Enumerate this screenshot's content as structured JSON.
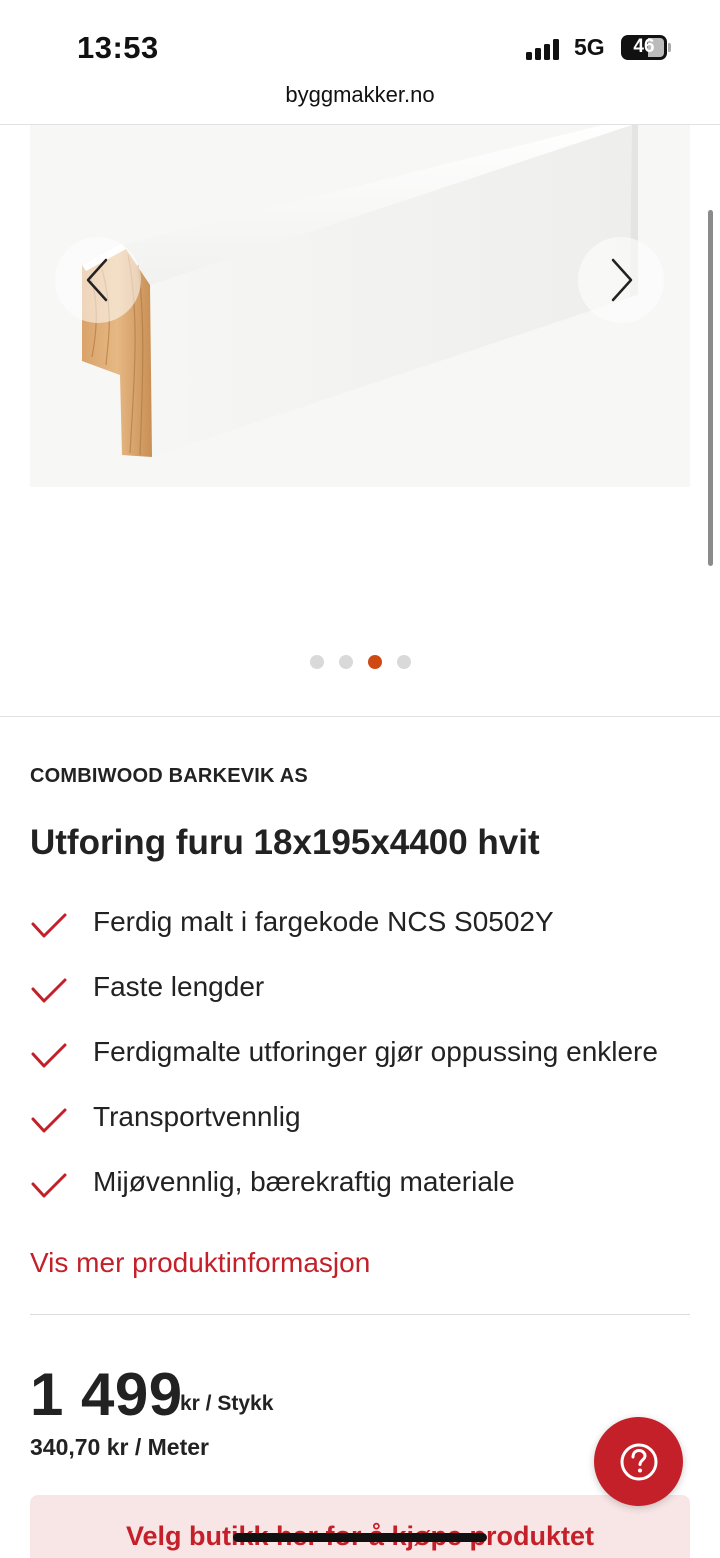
{
  "status_bar": {
    "time": "13:53",
    "network": "5G",
    "battery": "46"
  },
  "browser": {
    "url": "byggmakker.no"
  },
  "gallery": {
    "image": "white-painted-pine-casing-board",
    "prev_icon": "chevron-left-icon",
    "next_icon": "chevron-right-icon",
    "dots_count": 4,
    "active_dot": 3,
    "active_color": "#cf4a12"
  },
  "product": {
    "brand": "COMBIWOOD BARKEVIK AS",
    "title": "Utforing furu 18x195x4400 hvit",
    "features": [
      "Ferdig malt i fargekode NCS S0502Y",
      "Faste lengder",
      "Ferdigmalte utforinger gjør oppussing enklere",
      "Transportvennlig",
      "Mijøvennlig, bærekraftig materiale"
    ],
    "more_info_link": "Vis mer produktinformasjon"
  },
  "price": {
    "amount": "1 499",
    "unit": "kr / Stykk",
    "per_meter": "340,70 kr / Meter"
  },
  "help": {
    "icon": "question-mark-icon"
  },
  "cta": {
    "label": "Velg butikk her for å kjøpe produktet"
  },
  "colors": {
    "brand_red": "#c3202a",
    "cta_background": "#f8e6e6"
  }
}
